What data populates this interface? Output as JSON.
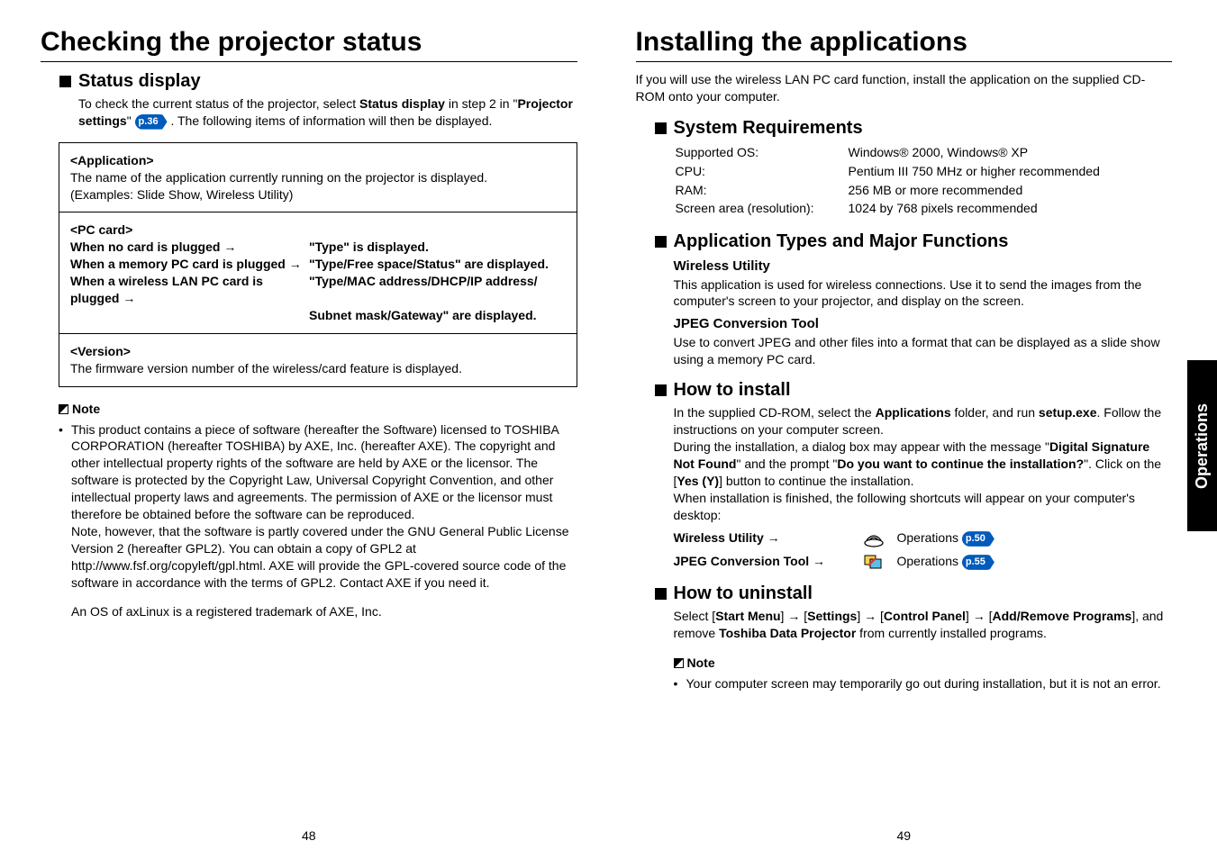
{
  "left": {
    "title": "Checking the projector status",
    "h_status": "Status display",
    "status_intro_1": "To check the current status of the projector, select ",
    "status_intro_bold1": "Status display",
    "status_intro_2": " in step 2 in \"",
    "status_intro_bold2": "Projector settings",
    "status_intro_3": "\" ",
    "status_badge": "p.36",
    "status_intro_4": " . The following items of information will then be displayed.",
    "box": {
      "app_t": "<Application>",
      "app_b1": "The name of the application currently running on the projector is displayed.",
      "app_b2": "(Examples: Slide Show, Wireless Utility)",
      "pc_t": "<PC card>",
      "pc_r1_l": "When no card is plugged →",
      "pc_r1_r": "\"Type\" is displayed.",
      "pc_r2_l": "When a memory PC card is plugged →",
      "pc_r2_r": "\"Type/Free space/Status\" are displayed.",
      "pc_r3_l": "When a wireless LAN PC card is plugged →",
      "pc_r3_r": "\"Type/MAC address/DHCP/IP address/",
      "pc_r4_r": "Subnet mask/Gateway\" are displayed.",
      "ver_t": "<Version>",
      "ver_b": "The firmware version number of the wireless/card feature is displayed."
    },
    "note_t": "Note",
    "note_body1": "This product contains a piece of software (hereafter the Software) licensed to TOSHIBA CORPORATION (hereafter TOSHIBA) by AXE, Inc. (hereafter AXE). The copyright and other intellectual property rights of the software are held by AXE or the licensor. The software is protected by the Copyright Law, Universal Copyright Convention, and other intellectual property laws and agreements. The permission of AXE or the licensor must therefore be obtained before the software can be reproduced.",
    "note_body2": "Note, however, that the software is partly covered under the GNU General Public License Version 2 (hereafter GPL2). You can obtain a copy of GPL2 at http://www.fsf.org/copyleft/gpl.html. AXE will provide the GPL-covered source code of the software in accordance with the terms of GPL2. Contact AXE if you need it.",
    "note_body3": "An OS of axLinux is a registered trademark of AXE, Inc.",
    "pgnum": "48"
  },
  "right": {
    "title": "Installing the applications",
    "intro": "If you will use the wireless LAN PC card function, install the application on the supplied CD-ROM onto your computer.",
    "h_req": "System Requirements",
    "req": {
      "os_l": "Supported OS:",
      "os_v": "Windows® 2000, Windows® XP",
      "cpu_l": "CPU:",
      "cpu_v": "Pentium III 750 MHz or higher recommended",
      "ram_l": "RAM:",
      "ram_v": "256 MB or more recommended",
      "res_l": "Screen area (resolution):",
      "res_v": "1024 by 768 pixels recommended"
    },
    "h_types": "Application Types and Major Functions",
    "wu_t": "Wireless Utility",
    "wu_b": "This application is used for wireless connections. Use it to send the images from the computer's screen to your projector, and display on the screen.",
    "jpeg_t": "JPEG Conversion Tool",
    "jpeg_b": "Use to convert JPEG and other files into a format that can be displayed as a slide show using a memory PC card.",
    "h_install": "How to install",
    "inst_1a": "In the supplied CD-ROM, select the ",
    "inst_1b": "Applications",
    "inst_1c": " folder, and run ",
    "inst_1d": "setup.exe",
    "inst_1e": ". Follow the instructions on your computer screen.",
    "inst_2a": "During the installation, a dialog box may appear with the message \"",
    "inst_2b": "Digital Signature Not Found",
    "inst_2c": "\" and the prompt \"",
    "inst_2d": "Do you want to continue the installation?",
    "inst_2e": "\". Click on the [",
    "inst_2f": "Yes (Y)",
    "inst_2g": "] button to continue the installation.",
    "inst_3": "When installation is finished, the following shortcuts will appear on your computer's desktop:",
    "sc1_l": "Wireless Utility →",
    "sc_op": "Operations ",
    "sc1_b": "p.50",
    "sc2_l": "JPEG Conversion Tool →",
    "sc2_b": "p.55",
    "h_uninstall": "How to uninstall",
    "un_1": "Select [",
    "un_2": "Start Menu",
    "un_3": "] → [",
    "un_4": "Settings",
    "un_5": "] → [",
    "un_6": "Control Panel",
    "un_7": "] → [",
    "un_8": "Add/Remove Programs",
    "un_9": "], and remove ",
    "un_10": "Toshiba Data Projector",
    "un_11": " from currently installed programs.",
    "note_t": "Note",
    "note_b": "Your computer screen may temporarily go out during installation, but it is not an error.",
    "pgnum": "49",
    "sidetab": "Operations"
  }
}
